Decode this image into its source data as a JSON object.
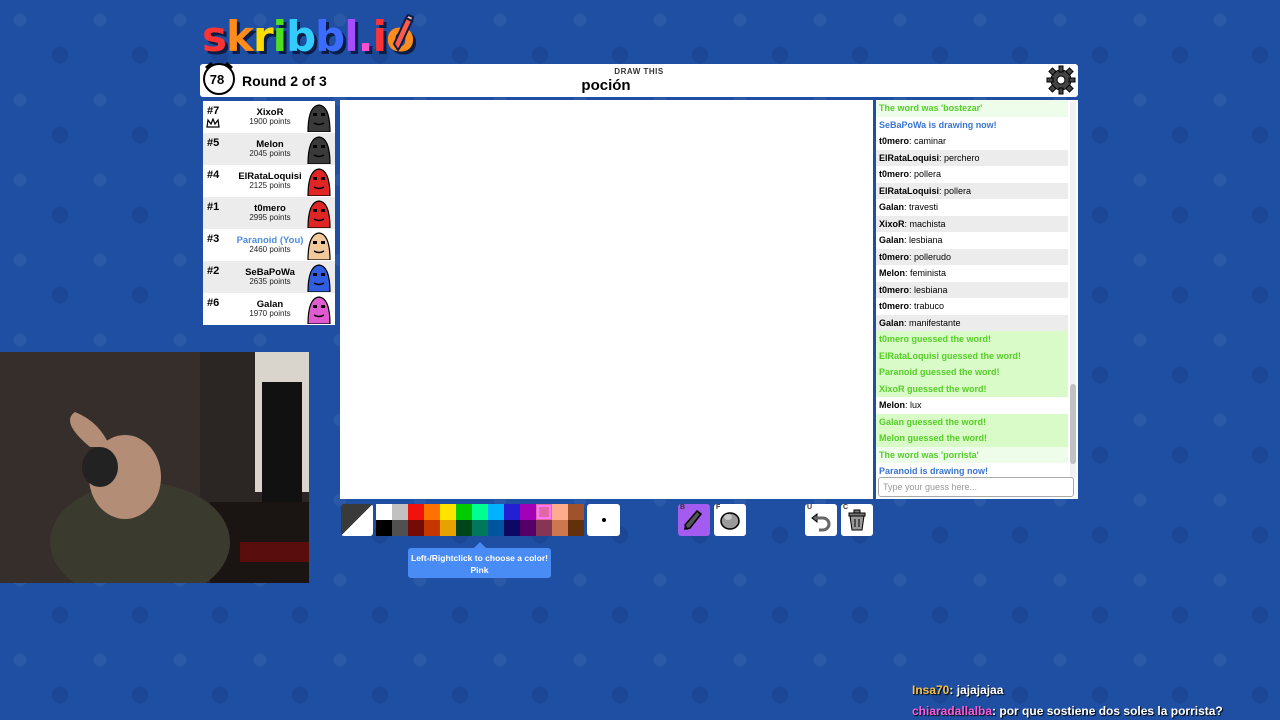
{
  "app": {
    "logo_text": "skribbl.io",
    "logo_colors": [
      "#ff3333",
      "#ff8c1a",
      "#ffdd00",
      "#4ce01f",
      "#33ccff",
      "#3b6cff",
      "#a64dff",
      "#ff4dd2",
      "#ff3333",
      "#ff8c1a"
    ]
  },
  "header": {
    "timer": "78",
    "round_text": "Round 2 of 3",
    "word_label": "DRAW THIS",
    "word": "poción",
    "settings_icon": "gear-icon"
  },
  "players": [
    {
      "rank": "#7",
      "name": "XixoR",
      "points": "1900 points",
      "avatar_color": "#3a3a3a",
      "you": false,
      "owner": true
    },
    {
      "rank": "#5",
      "name": "Melon",
      "points": "2045 points",
      "avatar_color": "#3a3a3a",
      "you": false,
      "owner": false
    },
    {
      "rank": "#4",
      "name": "ElRataLoquisi",
      "points": "2125 points",
      "avatar_color": "#e02525",
      "you": false,
      "owner": false
    },
    {
      "rank": "#1",
      "name": "t0mero",
      "points": "2995 points",
      "avatar_color": "#e02525",
      "you": false,
      "owner": false
    },
    {
      "rank": "#3",
      "name": "Paranoid (You)",
      "points": "2460 points",
      "avatar_color": "#f2c99a",
      "you": true,
      "owner": false
    },
    {
      "rank": "#2",
      "name": "SeBaPoWa",
      "points": "2635 points",
      "avatar_color": "#2f5fe0",
      "you": false,
      "owner": false
    },
    {
      "rank": "#6",
      "name": "Galan",
      "points": "1970 points",
      "avatar_color": "#e05ad0",
      "you": false,
      "owner": false
    }
  ],
  "chat": {
    "messages": [
      {
        "type": "green",
        "text": "The word was 'bostezar'"
      },
      {
        "type": "blue",
        "text": "SeBaPoWa is drawing now!"
      },
      {
        "type": "normal",
        "author": "t0mero",
        "text": "caminar"
      },
      {
        "type": "normal",
        "author": "ElRataLoquisi",
        "text": "perchero"
      },
      {
        "type": "normal",
        "author": "t0mero",
        "text": "pollera"
      },
      {
        "type": "normal",
        "author": "ElRataLoquisi",
        "text": "pollera"
      },
      {
        "type": "normal",
        "author": "Galan",
        "text": "travesti"
      },
      {
        "type": "normal",
        "author": "XixoR",
        "text": "machista"
      },
      {
        "type": "normal",
        "author": "Galan",
        "text": "lesbiana"
      },
      {
        "type": "normal",
        "author": "t0mero",
        "text": "pollerudo"
      },
      {
        "type": "normal",
        "author": "Melon",
        "text": "feminista"
      },
      {
        "type": "normal",
        "author": "t0mero",
        "text": "lesbiana"
      },
      {
        "type": "normal",
        "author": "t0mero",
        "text": "trabuco"
      },
      {
        "type": "normal",
        "author": "Galan",
        "text": "manifestante"
      },
      {
        "type": "green2",
        "text": "t0mero guessed the word!"
      },
      {
        "type": "green2",
        "text": "ElRataLoquisi guessed the word!"
      },
      {
        "type": "green2",
        "text": "Paranoid guessed the word!"
      },
      {
        "type": "green2",
        "text": "XixoR guessed the word!"
      },
      {
        "type": "normal",
        "author": "Melon",
        "text": "lux"
      },
      {
        "type": "green2",
        "text": "Galan guessed the word!"
      },
      {
        "type": "green2",
        "text": "Melon guessed the word!"
      },
      {
        "type": "green",
        "text": "The word was 'porrista'"
      },
      {
        "type": "blue",
        "text": "Paranoid is drawing now!"
      }
    ],
    "input_placeholder": "Type your guess here..."
  },
  "toolbar": {
    "palette_top": [
      "#ffffff",
      "#c1c1c1",
      "#ef130b",
      "#ff7100",
      "#ffe400",
      "#00cc00",
      "#00ff91",
      "#00b2ff",
      "#231fd3",
      "#a300ba",
      "#df69a7",
      "#ffac8e",
      "#a0522d"
    ],
    "palette_bottom": [
      "#000000",
      "#505050",
      "#740b07",
      "#c23800",
      "#e8a200",
      "#004619",
      "#00785d",
      "#00569e",
      "#0e0865",
      "#550069",
      "#873554",
      "#cc774d",
      "#63300d"
    ],
    "selected_swatch": 10,
    "tools": [
      {
        "key": "B",
        "icon": "pencil-icon"
      },
      {
        "key": "F",
        "icon": "fill-bucket-icon"
      },
      {
        "key": "U",
        "icon": "undo-icon"
      },
      {
        "key": "C",
        "icon": "trash-icon"
      }
    ]
  },
  "tooltip": {
    "line1": "Left-/Rightclick to choose a color!",
    "line2": "Pink"
  },
  "stream_chat": [
    {
      "user": "Insa70",
      "user_color": "#f2c14e",
      "text": ": jajajajaa"
    },
    {
      "user": "chiaradallalba",
      "user_color": "#ff5cdb",
      "text": ": por que sostiene dos soles la porrista?"
    }
  ]
}
